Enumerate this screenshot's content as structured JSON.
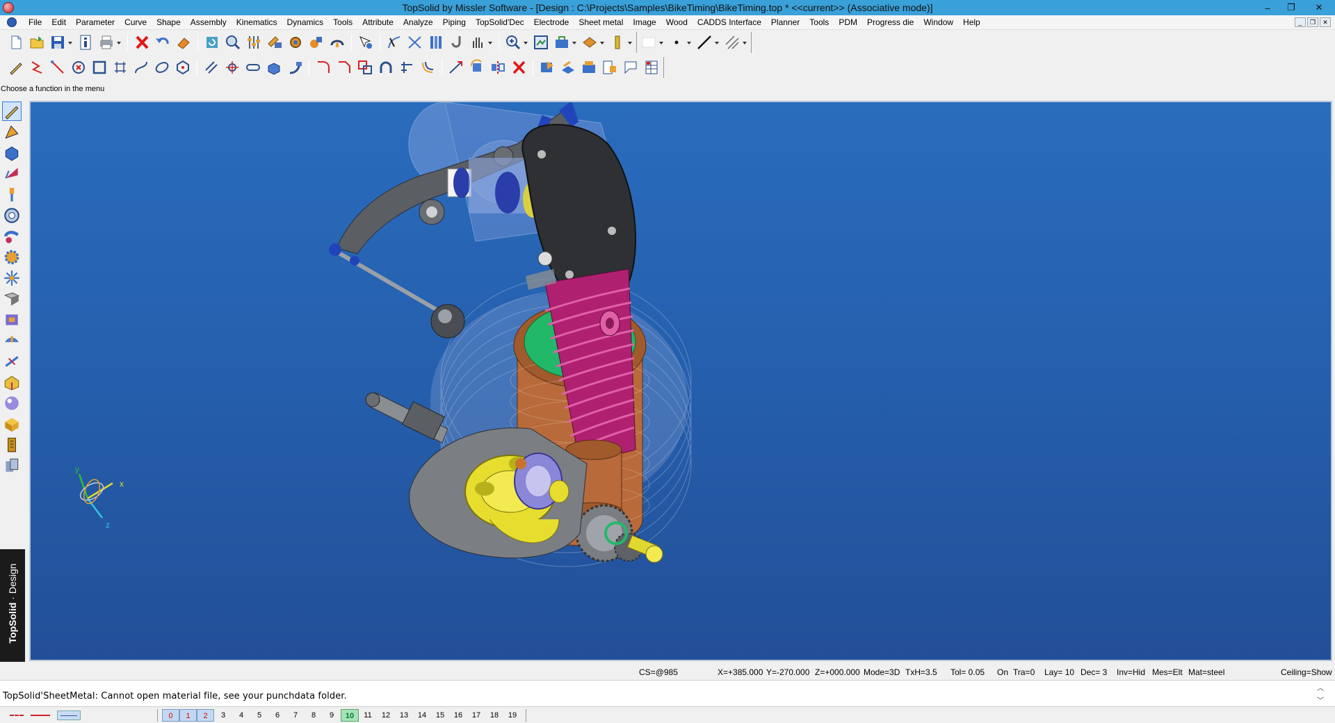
{
  "window": {
    "title": "TopSolid by Missler Software - [Design : C:\\Projects\\Samples\\BikeTiming\\BikeTiming.top *  <<current>> (Associative mode)]",
    "controls": {
      "minimize": "–",
      "restore": "❐",
      "close": "✕"
    }
  },
  "menu": {
    "items": [
      "File",
      "Edit",
      "Parameter",
      "Curve",
      "Shape",
      "Assembly",
      "Kinematics",
      "Dynamics",
      "Tools",
      "Attribute",
      "Analyze",
      "Piping",
      "TopSolid'Dec",
      "Electrode",
      "Sheet metal",
      "Image",
      "Wood",
      "CADDS Interface",
      "Planner",
      "Tools",
      "PDM",
      "Progress die",
      "Window",
      "Help"
    ],
    "mdi_controls": [
      "_",
      "❐",
      "✕"
    ]
  },
  "hint": "Choose a function in the menu",
  "design_tab": {
    "brand": "TopSolid",
    "mode": "Design"
  },
  "status": {
    "cs": "CS=@985",
    "x": "X=+385.000",
    "y": "Y=-270.000",
    "z": "Z=+000.000",
    "mode": "Mode=3D",
    "txh": "TxH=3.5",
    "tol": "Tol= 0.05",
    "on": "On",
    "tra": "Tra=0",
    "lay": "Lay= 10",
    "dec": "Dec= 3",
    "inv": "Inv=Hid",
    "mes": "Mes=Elt",
    "mat": "Mat=steel",
    "ceiling": "Ceiling=Show"
  },
  "message": "TopSolid'SheetMetal: Cannot open material file, see your punchdata folder.",
  "layers": {
    "highlighted": [
      "0",
      "1",
      "2"
    ],
    "numbers": [
      "3",
      "4",
      "5",
      "6",
      "7",
      "8",
      "9"
    ],
    "current": "10",
    "after": [
      "11",
      "12",
      "13",
      "14",
      "15",
      "16",
      "17",
      "18",
      "19"
    ]
  },
  "axes": {
    "x": "x",
    "y": "y",
    "z": "z"
  },
  "colors": {
    "viewport_top": "#2a6cbd",
    "viewport_bottom": "#234f98",
    "spring": "#c02a7a",
    "cylinder_copper": "#b86a3a",
    "piston_green": "#22b86a",
    "crank_yellow": "#e0d830"
  }
}
